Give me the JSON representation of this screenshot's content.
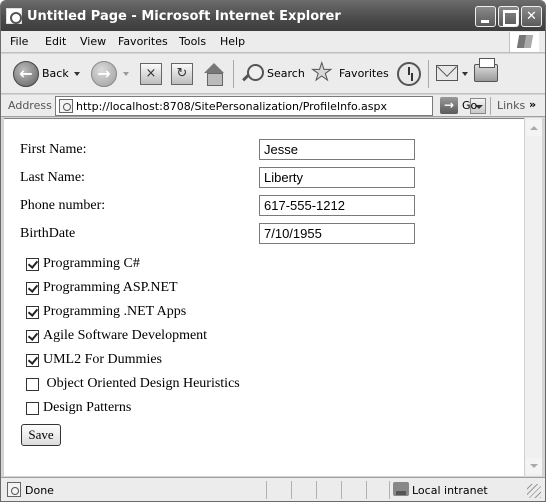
{
  "window": {
    "title": "Untitled Page - Microsoft Internet Explorer"
  },
  "menu": [
    "File",
    "Edit",
    "View",
    "Favorites",
    "Tools",
    "Help"
  ],
  "toolbar": {
    "back_label": "Back",
    "back_arrow": "←",
    "forward_arrow": "→",
    "stop_glyph": "×",
    "refresh_glyph": "↻",
    "search_label": "Search",
    "star_glyph": "★",
    "favorites_label": "Favorites"
  },
  "address": {
    "label": "Address",
    "url": "http://localhost:8708/SitePersonalization/ProfileInfo.aspx",
    "go_arrow": "→",
    "go_label": "Go",
    "links_label": "Links",
    "links_more": "»"
  },
  "form": {
    "fields": [
      {
        "label": "First Name:",
        "value": "Jesse"
      },
      {
        "label": "Last Name:",
        "value": "Liberty"
      },
      {
        "label": "Phone number:",
        "value": "617-555-1212"
      },
      {
        "label": "BirthDate",
        "value": "7/10/1955"
      }
    ],
    "books": [
      {
        "label": "Programming C#",
        "checked": true
      },
      {
        "label": "Programming ASP.NET",
        "checked": true
      },
      {
        "label": "Programming .NET Apps",
        "checked": true
      },
      {
        "label": "Agile Software Development",
        "checked": true
      },
      {
        "label": "UML2 For Dummies",
        "checked": true
      },
      {
        "label": " Object Oriented Design Heuristics",
        "checked": false
      },
      {
        "label": "Design Patterns",
        "checked": false
      }
    ],
    "save_label": "Save"
  },
  "status": {
    "text": "Done",
    "zone": "Local intranet"
  },
  "icons": {
    "browser": "ie-page-icon",
    "back": "back-arrow-icon",
    "forward": "forward-arrow-icon",
    "stop": "stop-icon",
    "refresh": "refresh-icon",
    "home": "home-icon",
    "search": "search-icon",
    "favorites": "favorites-star-icon",
    "history": "history-icon",
    "mail": "mail-icon",
    "print": "print-icon",
    "go": "go-arrow-icon",
    "zone": "local-intranet-icon"
  }
}
